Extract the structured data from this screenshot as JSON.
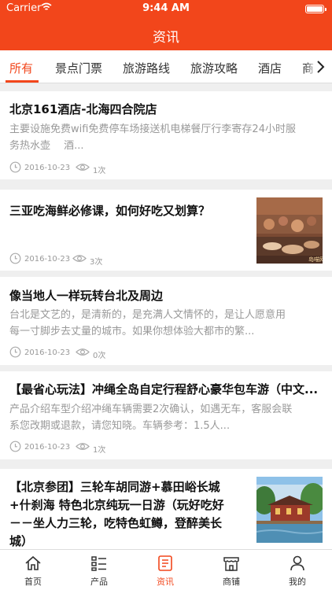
{
  "status_bar": {
    "carrier": "Carrier",
    "time": "9:44 AM"
  },
  "header": {
    "title": "资讯"
  },
  "tabs": [
    "所有",
    "景点门票",
    "旅游路线",
    "旅游攻略",
    "酒店",
    "商"
  ],
  "articles": [
    {
      "title": "北京161酒店-北海四合院店",
      "desc_line1": "主要设施免费wifi免费停车场接送机电梯餐厅行李寄存24小时服",
      "desc_line2": "务热水壶　 酒...",
      "date": "2016-10-23",
      "views": "1次"
    },
    {
      "title": "三亚吃海鲜必修课，如何好吃又划算？",
      "date": "2016-10-23",
      "views": "3次",
      "thumb_caption": "岛喵网"
    },
    {
      "title": "像当地人一样玩转台北及周边",
      "desc_line1": "台北是文艺的，是清新的，是充满人文情怀的，是让人愿意用",
      "desc_line2": "每一寸脚步去丈量的城市。如果你想体验大都市的繁...",
      "date": "2016-10-23",
      "views": "0次"
    },
    {
      "title": "【最省心玩法】冲绳全岛自定行程舒心豪华包车游（中文...",
      "desc_line1": "产品介绍车型介绍冲绳车辆需要2次确认，如遇无车，客服会联",
      "desc_line2": "系您改期或退款，请您知晓。车辆参考：1.5人...",
      "date": "2016-10-23",
      "views": "1次"
    },
    {
      "title_lines": [
        "【北京参团】三轮车胡同游+慕田峪长城",
        "+什刹海 特色北京纯玩一日游（玩好吃好",
        "－－坐人力三轮，吃特色虹鳟，登醉美长",
        "城）"
      ]
    }
  ],
  "tabbar": [
    {
      "label": "首页",
      "icon": "home-icon"
    },
    {
      "label": "产品",
      "icon": "product-list-icon"
    },
    {
      "label": "资讯",
      "icon": "news-icon"
    },
    {
      "label": "商铺",
      "icon": "shop-icon"
    },
    {
      "label": "我的",
      "icon": "profile-icon"
    }
  ],
  "colors": {
    "accent": "#f2461b",
    "muted_text": "#999999",
    "background": "#efefef"
  }
}
